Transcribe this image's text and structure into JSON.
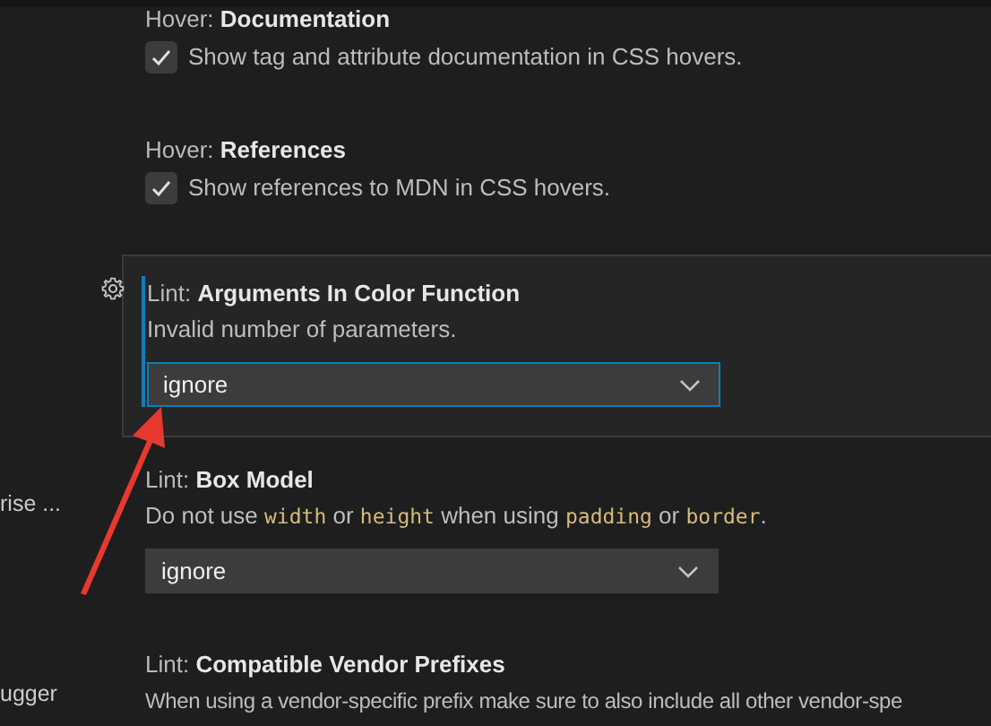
{
  "sidebar": {
    "items": [
      {
        "label": "rise ..."
      },
      {
        "label": "ugger"
      }
    ]
  },
  "settings": [
    {
      "kind": "checkbox",
      "category": "Hover: ",
      "name": "Documentation",
      "description": [
        {
          "text": "Show tag and attribute documentation in CSS hovers.",
          "code": false
        }
      ],
      "checked": true,
      "focused": false
    },
    {
      "kind": "checkbox",
      "category": "Hover: ",
      "name": "References",
      "description": [
        {
          "text": "Show references to MDN in CSS hovers.",
          "code": false
        }
      ],
      "checked": true,
      "focused": false
    },
    {
      "kind": "dropdown",
      "category": "Lint: ",
      "name": "Arguments In Color Function",
      "description": [
        {
          "text": "Invalid number of parameters.",
          "code": false
        }
      ],
      "value": "ignore",
      "focused": true
    },
    {
      "kind": "dropdown",
      "category": "Lint: ",
      "name": "Box Model",
      "description": [
        {
          "text": "Do not use ",
          "code": false
        },
        {
          "text": "width",
          "code": true
        },
        {
          "text": " or ",
          "code": false
        },
        {
          "text": "height",
          "code": true
        },
        {
          "text": " when using ",
          "code": false
        },
        {
          "text": "padding",
          "code": true
        },
        {
          "text": " or ",
          "code": false
        },
        {
          "text": "border",
          "code": true
        },
        {
          "text": ".",
          "code": false
        }
      ],
      "value": "ignore",
      "focused": false
    },
    {
      "kind": "text",
      "category": "Lint: ",
      "name": "Compatible Vendor Prefixes",
      "description": [
        {
          "text": "When using a vendor-specific prefix make sure to also include all other vendor-spe",
          "code": false
        }
      ],
      "focused": false
    }
  ]
}
